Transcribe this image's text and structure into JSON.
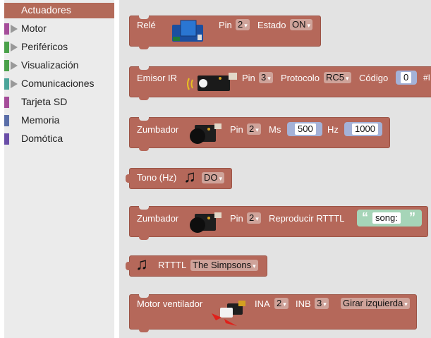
{
  "sidebar": {
    "categories": [
      {
        "label": "Actuadores",
        "color": "#b36a59",
        "selected": true
      },
      {
        "label": "Motor",
        "color": "#a54d9a"
      },
      {
        "label": "Periféricos",
        "color": "#4aa14a"
      },
      {
        "label": "Visualización",
        "color": "#4aa14a"
      },
      {
        "label": "Comunicaciones",
        "color": "#4aa59a"
      },
      {
        "label": "Tarjeta SD",
        "color": "#a54d9a"
      },
      {
        "label": "Memoria",
        "color": "#5a6ea8"
      },
      {
        "label": "Domótica",
        "color": "#6a4ea8"
      }
    ]
  },
  "blocks": {
    "rele": {
      "title": "Relé",
      "pin_label": "Pin",
      "pin_value": "2",
      "estado_label": "Estado",
      "estado_value": "ON"
    },
    "emisor_ir": {
      "title": "Emisor IR",
      "pin_label": "Pin",
      "pin_value": "3",
      "protocolo_label": "Protocolo",
      "protocolo_value": "RC5",
      "codigo_label": "Código",
      "codigo_value": "0",
      "overflow": "#I"
    },
    "zumbador1": {
      "title": "Zumbador",
      "pin_label": "Pin",
      "pin_value": "2",
      "ms_label": "Ms",
      "ms_value": "500",
      "hz_label": "Hz",
      "hz_value": "1000"
    },
    "tono": {
      "title": "Tono (Hz)",
      "note_value": "DO"
    },
    "zumbador2": {
      "title": "Zumbador",
      "pin_label": "Pin",
      "pin_value": "2",
      "rtttl_label": "Reproducir RTTTL",
      "open_quote": "“",
      "song_value": "song:",
      "close_quote": "”"
    },
    "rtttl": {
      "title": "RTTTL",
      "song_value": "The Simpsons"
    },
    "motor_ventilador": {
      "title": "Motor ventilador",
      "ina_label": "INA",
      "ina_value": "2",
      "inb_label": "INB",
      "inb_value": "3",
      "direction_value": "Girar izquierda"
    }
  },
  "icons": {
    "dropdown": "▾",
    "music_note": "♫"
  }
}
